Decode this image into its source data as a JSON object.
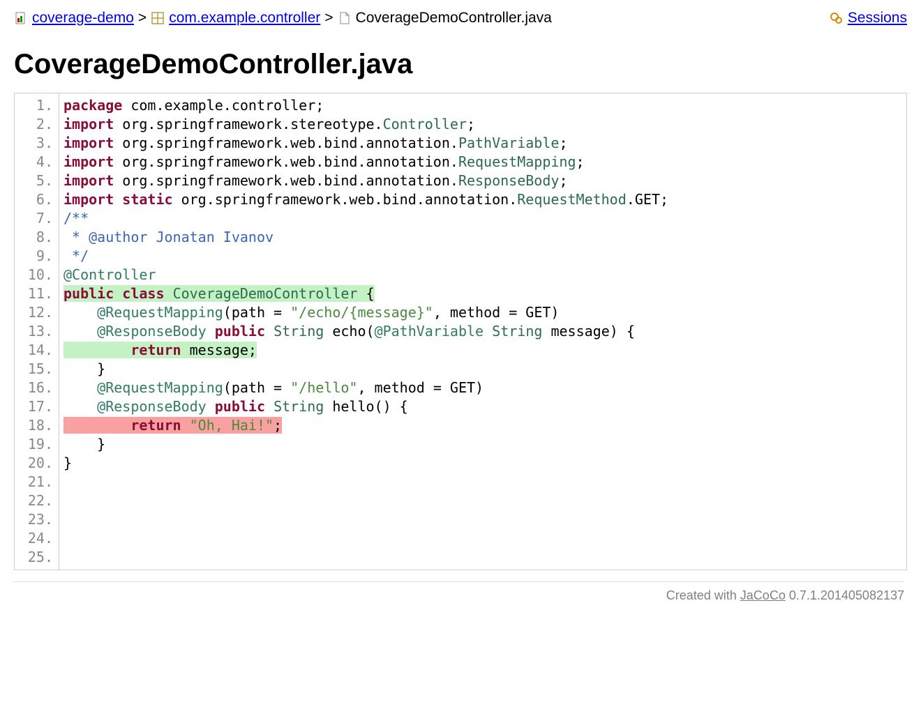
{
  "breadcrumb": {
    "root": "coverage-demo",
    "pkg": "com.example.controller",
    "file": "CoverageDemoController.java",
    "sep": ">",
    "sessions": "Sessions"
  },
  "page_title": "CoverageDemoController.java",
  "code": {
    "line_count": 25,
    "lines": [
      {
        "n": 1,
        "cov": "",
        "frags": [
          [
            "kw",
            "package"
          ],
          [
            "",
            " com.example.controller;"
          ]
        ]
      },
      {
        "n": 2,
        "cov": "",
        "frags": [
          [
            "",
            ""
          ]
        ]
      },
      {
        "n": 3,
        "cov": "",
        "frags": [
          [
            "kw",
            "import"
          ],
          [
            "",
            " org.springframework.stereotype."
          ],
          [
            "type",
            "Controller"
          ],
          [
            "",
            ";"
          ]
        ]
      },
      {
        "n": 4,
        "cov": "",
        "frags": [
          [
            "kw",
            "import"
          ],
          [
            "",
            " org.springframework.web.bind.annotation."
          ],
          [
            "type",
            "PathVariable"
          ],
          [
            "",
            ";"
          ]
        ]
      },
      {
        "n": 5,
        "cov": "",
        "frags": [
          [
            "kw",
            "import"
          ],
          [
            "",
            " org.springframework.web.bind.annotation."
          ],
          [
            "type",
            "RequestMapping"
          ],
          [
            "",
            ";"
          ]
        ]
      },
      {
        "n": 6,
        "cov": "",
        "frags": [
          [
            "kw",
            "import"
          ],
          [
            "",
            " org.springframework.web.bind.annotation."
          ],
          [
            "type",
            "ResponseBody"
          ],
          [
            "",
            ";"
          ]
        ]
      },
      {
        "n": 7,
        "cov": "",
        "frags": [
          [
            "",
            ""
          ]
        ]
      },
      {
        "n": 8,
        "cov": "",
        "frags": [
          [
            "kw",
            "import"
          ],
          [
            "",
            " "
          ],
          [
            "kw",
            "static"
          ],
          [
            "",
            " org.springframework.web.bind.annotation."
          ],
          [
            "type",
            "RequestMethod"
          ],
          [
            "",
            ".GET;"
          ]
        ]
      },
      {
        "n": 9,
        "cov": "",
        "frags": [
          [
            "",
            ""
          ]
        ]
      },
      {
        "n": 10,
        "cov": "",
        "frags": [
          [
            "cmt",
            "/**"
          ]
        ]
      },
      {
        "n": 11,
        "cov": "",
        "frags": [
          [
            "cmt",
            " * @author Jonatan Ivanov"
          ]
        ]
      },
      {
        "n": 12,
        "cov": "",
        "frags": [
          [
            "cmt",
            " */"
          ]
        ]
      },
      {
        "n": 13,
        "cov": "",
        "frags": [
          [
            "ann",
            "@Controller"
          ]
        ]
      },
      {
        "n": 14,
        "cov": "full",
        "frags": [
          [
            "kw",
            "public"
          ],
          [
            "",
            " "
          ],
          [
            "kw",
            "class"
          ],
          [
            "",
            " "
          ],
          [
            "type",
            "CoverageDemoController"
          ],
          [
            "",
            " {"
          ]
        ]
      },
      {
        "n": 15,
        "cov": "",
        "frags": [
          [
            "",
            ""
          ]
        ]
      },
      {
        "n": 16,
        "cov": "",
        "frags": [
          [
            "",
            "    "
          ],
          [
            "ann",
            "@RequestMapping"
          ],
          [
            "",
            "(path = "
          ],
          [
            "str",
            "\"/echo/{message}\""
          ],
          [
            "",
            ", method = GET)"
          ]
        ]
      },
      {
        "n": 17,
        "cov": "",
        "frags": [
          [
            "",
            "    "
          ],
          [
            "ann",
            "@ResponseBody"
          ],
          [
            "",
            " "
          ],
          [
            "kw",
            "public"
          ],
          [
            "",
            " "
          ],
          [
            "type",
            "String"
          ],
          [
            "",
            " echo("
          ],
          [
            "ann",
            "@PathVariable"
          ],
          [
            "",
            " "
          ],
          [
            "type",
            "String"
          ],
          [
            "",
            " message) {"
          ]
        ]
      },
      {
        "n": 18,
        "cov": "full",
        "frags": [
          [
            "",
            "        "
          ],
          [
            "kw",
            "return"
          ],
          [
            "",
            " message;"
          ]
        ]
      },
      {
        "n": 19,
        "cov": "",
        "frags": [
          [
            "",
            "    }"
          ]
        ]
      },
      {
        "n": 20,
        "cov": "",
        "frags": [
          [
            "",
            ""
          ]
        ]
      },
      {
        "n": 21,
        "cov": "",
        "frags": [
          [
            "",
            "    "
          ],
          [
            "ann",
            "@RequestMapping"
          ],
          [
            "",
            "(path = "
          ],
          [
            "str",
            "\"/hello\""
          ],
          [
            "",
            ", method = GET)"
          ]
        ]
      },
      {
        "n": 22,
        "cov": "",
        "frags": [
          [
            "",
            "    "
          ],
          [
            "ann",
            "@ResponseBody"
          ],
          [
            "",
            " "
          ],
          [
            "kw",
            "public"
          ],
          [
            "",
            " "
          ],
          [
            "type",
            "String"
          ],
          [
            "",
            " hello() {"
          ]
        ]
      },
      {
        "n": 23,
        "cov": "none",
        "frags": [
          [
            "",
            "        "
          ],
          [
            "kw",
            "return"
          ],
          [
            "",
            " "
          ],
          [
            "str",
            "\"Oh, Hai!\""
          ],
          [
            "",
            ";"
          ]
        ]
      },
      {
        "n": 24,
        "cov": "",
        "frags": [
          [
            "",
            "    }"
          ]
        ]
      },
      {
        "n": 25,
        "cov": "",
        "frags": [
          [
            "",
            "}"
          ]
        ]
      }
    ]
  },
  "footer": {
    "prefix": "Created with ",
    "tool": "JaCoCo",
    "version": " 0.7.1.201405082137"
  }
}
